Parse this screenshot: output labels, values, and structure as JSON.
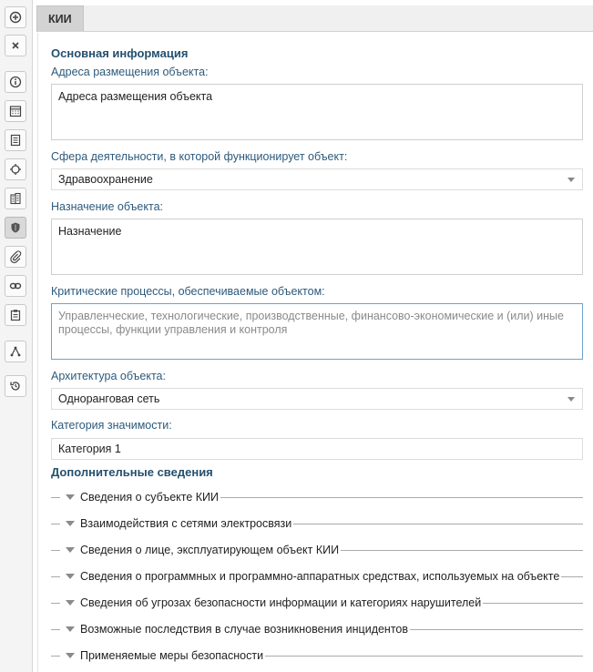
{
  "tab": {
    "label": "КИИ"
  },
  "toolbar": {
    "buttons": [
      {
        "icon": "add-circle-icon"
      },
      {
        "icon": "close-icon"
      },
      {
        "icon": "info-icon"
      },
      {
        "icon": "calendar-icon"
      },
      {
        "icon": "document-icon"
      },
      {
        "icon": "target-icon"
      },
      {
        "icon": "building-icon"
      },
      {
        "icon": "shield-icon",
        "active": true
      },
      {
        "icon": "paperclip-icon"
      },
      {
        "icon": "link-icon"
      },
      {
        "icon": "clipboard-icon"
      },
      {
        "icon": "hierarchy-icon"
      },
      {
        "icon": "history-icon"
      }
    ]
  },
  "main": {
    "section_title": "Основная информация",
    "address": {
      "label": "Адреса размещения объекта:",
      "value": "Адреса размещения объекта"
    },
    "sphere": {
      "label": "Сфера деятельности, в которой функционирует объект:",
      "value": "Здравоохранение"
    },
    "purpose": {
      "label": "Назначение объекта:",
      "value": "Назначение"
    },
    "processes": {
      "label": "Критические процессы, обеспечиваемые объектом:",
      "placeholder": "Управленческие, технологические, производственные, финансово-экономические и (или) иные процессы, функции управления и контроля"
    },
    "architecture": {
      "label": "Архитектура объекта:",
      "value": "Одноранговая сеть"
    },
    "category": {
      "label": "Категория значимости:",
      "value": "Категория 1"
    }
  },
  "additional": {
    "title": "Дополнительные сведения",
    "sections": [
      "Сведения о субъекте КИИ",
      "Взаимодействия с сетями электросвязи",
      "Сведения о лице, эксплуатирующем объект КИИ",
      "Сведения о программных и программно-аппаратных средствах, используемых на объекте",
      "Сведения об угрозах безопасности информации и категориях нарушителей",
      "Возможные последствия в случае возникновения инцидентов",
      "Применяемые меры безопасности"
    ]
  }
}
